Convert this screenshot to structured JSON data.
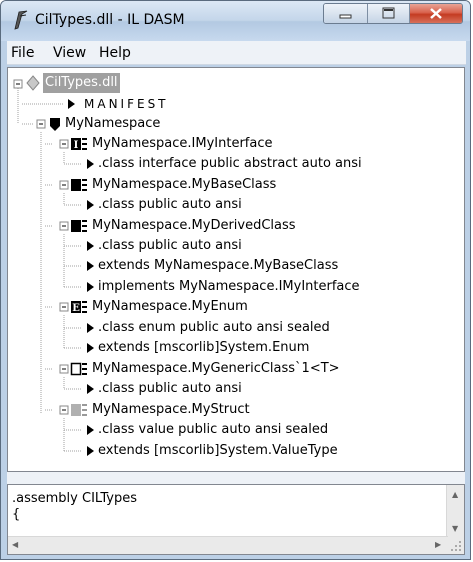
{
  "window": {
    "title": "CilTypes.dll - IL DASM"
  },
  "menu": {
    "items": [
      "File",
      "View",
      "Help"
    ]
  },
  "tree": {
    "root": "CilTypes.dll",
    "manifest": "MANIFEST",
    "namespace": "MyNamespace",
    "types": [
      {
        "name": "MyNamespace.IMyInterface",
        "icon": "interface-icon",
        "members": [
          ".class interface public abstract auto ansi"
        ]
      },
      {
        "name": "MyNamespace.MyBaseClass",
        "icon": "class-icon",
        "members": [
          ".class public auto ansi"
        ]
      },
      {
        "name": "MyNamespace.MyDerivedClass",
        "icon": "class-icon",
        "members": [
          ".class public auto ansi",
          "extends MyNamespace.MyBaseClass",
          "implements MyNamespace.IMyInterface"
        ]
      },
      {
        "name": "MyNamespace.MyEnum",
        "icon": "enum-icon",
        "members": [
          ".class enum public auto ansi sealed",
          "extends [mscorlib]System.Enum"
        ]
      },
      {
        "name": "MyNamespace.MyGenericClass`1<T>",
        "icon": "generic-class-icon",
        "members": [
          ".class public auto ansi"
        ]
      },
      {
        "name": "MyNamespace.MyStruct",
        "icon": "struct-icon",
        "members": [
          ".class value public auto ansi sealed",
          "extends [mscorlib]System.ValueType"
        ]
      }
    ]
  },
  "code_pane": {
    "lines": [
      ".assembly CILTypes",
      "{"
    ]
  }
}
